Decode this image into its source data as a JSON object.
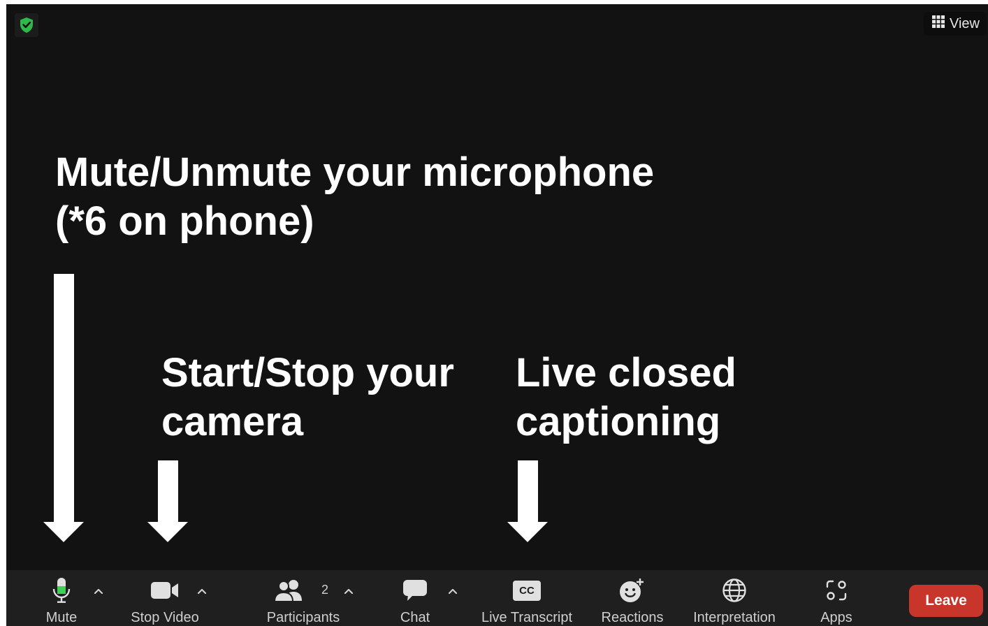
{
  "header": {
    "view_label": "View"
  },
  "annotations": {
    "mute_line1": "Mute/Unmute your microphone",
    "mute_line2": "(*6 on phone)",
    "video_line1": "Start/Stop your",
    "video_line2": "camera",
    "cc_line1": "Live closed",
    "cc_line2": "captioning"
  },
  "toolbar": {
    "mute_label": "Mute",
    "stop_video_label": "Stop Video",
    "participants_label": "Participants",
    "participants_count": "2",
    "chat_label": "Chat",
    "live_transcript_label": "Live Transcript",
    "cc_badge": "CC",
    "reactions_label": "Reactions",
    "interpretation_label": "Interpretation",
    "apps_label": "Apps",
    "leave_label": "Leave"
  },
  "colors": {
    "background": "#121212",
    "toolbar": "#1f1f1f",
    "leave": "#c8352b",
    "shield_green": "#2db84a",
    "mic_green": "#3fcf55"
  },
  "icons": [
    "shield-check-icon",
    "grid-icon",
    "microphone-icon",
    "video-camera-icon",
    "participants-icon",
    "chat-icon",
    "cc-icon",
    "reactions-icon",
    "globe-icon",
    "apps-icon",
    "caret-up-icon"
  ]
}
